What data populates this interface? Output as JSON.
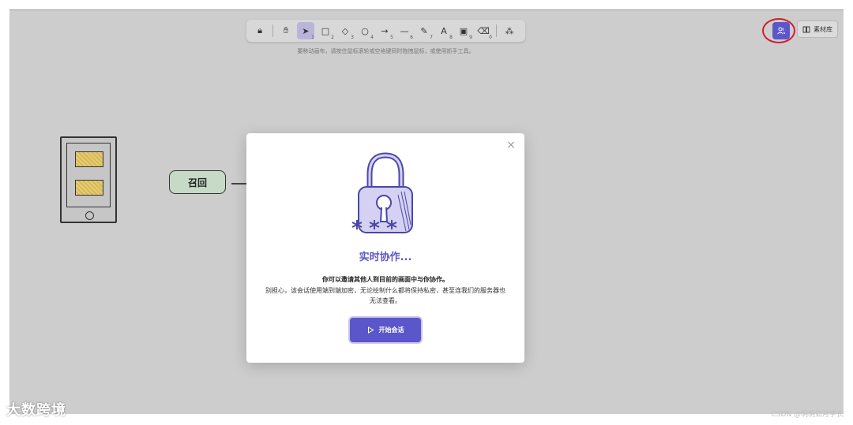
{
  "toolbar": {
    "tools": [
      {
        "name": "lock",
        "glyph": "🔒︎",
        "key": ""
      },
      {
        "name": "hand",
        "glyph": "✋︎",
        "key": ""
      },
      {
        "name": "select",
        "glyph": "➤",
        "key": "1",
        "active": true
      },
      {
        "name": "rectangle",
        "glyph": "□",
        "key": "2"
      },
      {
        "name": "diamond",
        "glyph": "◇",
        "key": "3"
      },
      {
        "name": "ellipse",
        "glyph": "○",
        "key": "4"
      },
      {
        "name": "arrow",
        "glyph": "→",
        "key": "5"
      },
      {
        "name": "line",
        "glyph": "—",
        "key": "6"
      },
      {
        "name": "draw",
        "glyph": "✎",
        "key": "7"
      },
      {
        "name": "text",
        "glyph": "A",
        "key": "8"
      },
      {
        "name": "image",
        "glyph": "▣",
        "key": "9"
      },
      {
        "name": "eraser",
        "glyph": "⌫",
        "key": "0"
      },
      {
        "name": "shapes",
        "glyph": "⁂",
        "key": ""
      }
    ]
  },
  "hint": "要移动画布，请按住鼠标滚轮或空格键同时拖拽鼠标，或使用抓手工具。",
  "library_label": "素材库",
  "canvas": {
    "recall_label": "召回"
  },
  "modal": {
    "title": "实时协作...",
    "desc_bold": "你可以邀请其他人到目前的画面中与你协作。",
    "desc": "别担心，该会话使用端到端加密，无论绘制什么都将保持私密，甚至连我们的服务器也无法查看。",
    "start_label": "开始会话",
    "close_glyph": "×"
  },
  "watermark_left": "大数跨境",
  "watermark_right": "CSDN @明明如月学长",
  "colors": {
    "accent": "#5b56c9",
    "canvas": "#cdcdcd",
    "highlight": "#d01f2a"
  }
}
